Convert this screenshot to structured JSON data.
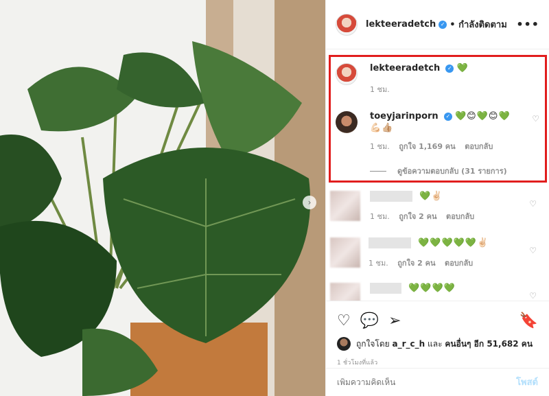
{
  "post": {
    "author": "lekteeradetch",
    "following_label": "• กำลังติดตาม",
    "more_icon": "more-options-icon"
  },
  "highlight_color": "#e11d1d",
  "comments": [
    {
      "username": "lekteeradetch",
      "text": "💚",
      "time": "1 ชม."
    },
    {
      "username": "toeyjarinporn",
      "text": "💚😊💚😊💚",
      "text2": "💪🏻👍🏼",
      "time": "1 ชม.",
      "likes": "ถูกใจ 1,169 คน",
      "reply": "ตอบกลับ",
      "view_replies": "ดูข้อความตอบกลับ (31 รายการ)"
    },
    {
      "text": "💚✌🏻",
      "time": "1 ชม.",
      "likes": "ถูกใจ 2 คน",
      "reply": "ตอบกลับ"
    },
    {
      "text": "💚💚💚💚💚✌🏻",
      "time": "1 ชม.",
      "likes": "ถูกใจ 2 คน",
      "reply": "ตอบกลับ"
    },
    {
      "text": "💚💚💚💚"
    }
  ],
  "likes_bar": {
    "prefix": "ถูกใจโดย",
    "user": "a_r_c_h",
    "and": "และ",
    "others": "คนอื่นๆ อีก 51,682 คน"
  },
  "posted_time": "1 ชั่วโมงที่แล้ว",
  "add_comment": {
    "placeholder": "เพิ่มความคิดเห็น",
    "post_label": "โพสต์"
  }
}
